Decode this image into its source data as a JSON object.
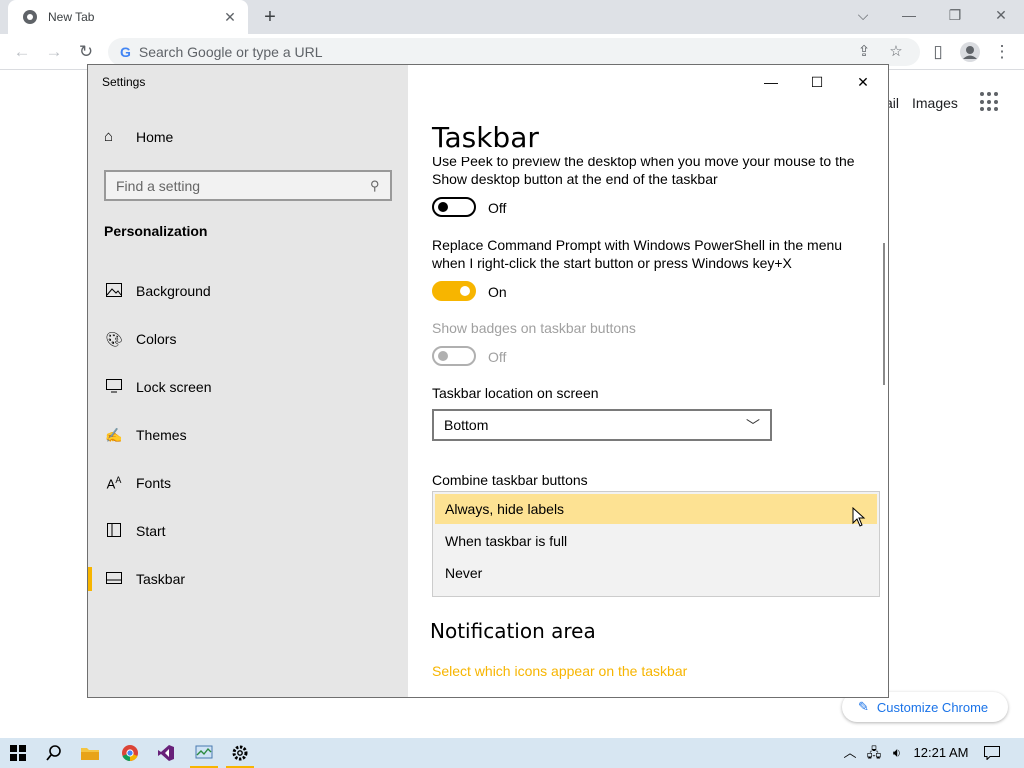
{
  "browser": {
    "tab_title": "New Tab",
    "tab_close": "✕",
    "new_tab": "+",
    "omnibox_placeholder": "Search Google or type a URL",
    "g_letter": "G",
    "page_links": {
      "gmail_partial": "ail",
      "images": "Images"
    },
    "customize_label": "Customize Chrome"
  },
  "settings": {
    "window_title": "Settings",
    "home_label": "Home",
    "search_placeholder": "Find a setting",
    "section": "Personalization",
    "nav": [
      {
        "label": "Background",
        "icon": "picture-icon"
      },
      {
        "label": "Colors",
        "icon": "palette-icon"
      },
      {
        "label": "Lock screen",
        "icon": "monitor-icon"
      },
      {
        "label": "Themes",
        "icon": "brush-icon"
      },
      {
        "label": "Fonts",
        "icon": "font-icon"
      },
      {
        "label": "Start",
        "icon": "start-icon"
      },
      {
        "label": "Taskbar",
        "icon": "taskbar-icon",
        "active": true
      }
    ],
    "page_title": "Taskbar",
    "peek_text_line1": "Use Peek to preview the desktop when you move your mouse to the",
    "peek_text_line2": "Show desktop button at the end of the taskbar",
    "peek_toggle_state": "Off",
    "powershell_line1": "Replace Command Prompt with Windows PowerShell in the menu",
    "powershell_line2": "when I right-click the start button or press Windows key+X",
    "powershell_toggle_state": "On",
    "badges_label": "Show badges on taskbar buttons",
    "badges_toggle_state": "Off",
    "location_label": "Taskbar location on screen",
    "location_value": "Bottom",
    "combine_label": "Combine taskbar buttons",
    "combine_options": [
      "Always, hide labels",
      "When taskbar is full",
      "Never"
    ],
    "combine_highlighted": "Always, hide labels",
    "notification_heading": "Notification area",
    "notification_link": "Select which icons appear on the taskbar"
  },
  "taskbar": {
    "clock": "12:21 AM"
  },
  "colors": {
    "accent": "#f7b500",
    "highlight": "#fde293",
    "taskbar_bg": "#d7e6f2"
  }
}
